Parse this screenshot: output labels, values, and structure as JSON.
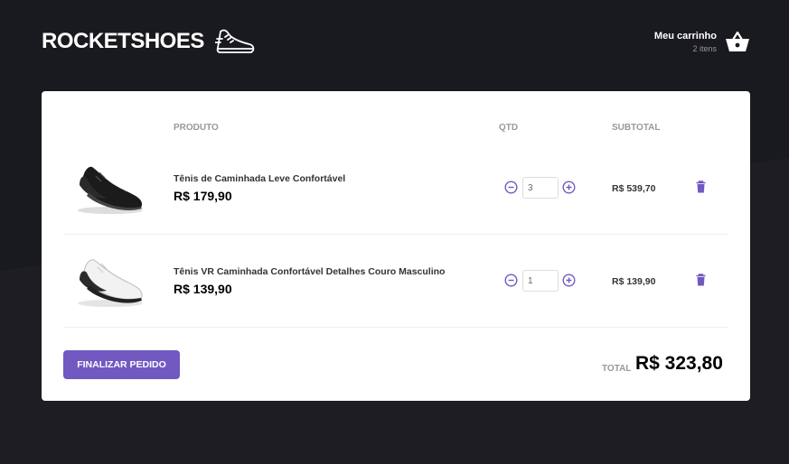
{
  "header": {
    "logo_text": "ROCKETSHOES",
    "logo_icon": "sneaker-icon",
    "cart_title": "Meu carrinho",
    "cart_count": "2 itens",
    "cart_icon": "basket-icon"
  },
  "table": {
    "col_product": "PRODUTO",
    "col_qty": "QTD",
    "col_subtotal": "SUBTOTAL"
  },
  "items": [
    {
      "image": "black-sneaker",
      "title": "Tênis de Caminhada Leve Confortável",
      "price": "R$ 179,90",
      "quantity": "3",
      "subtotal": "R$ 539,70"
    },
    {
      "image": "white-sneaker",
      "title": "Tênis VR Caminhada Confortável Detalhes Couro Masculino",
      "price": "R$ 139,90",
      "quantity": "1",
      "subtotal": "R$ 139,90"
    }
  ],
  "footer": {
    "finalize_label": "FINALIZAR PEDIDO",
    "total_label": "TOTAL",
    "total_value": "R$ 323,80"
  },
  "colors": {
    "background": "#191920",
    "accent": "#7159c1",
    "card": "#ffffff"
  }
}
